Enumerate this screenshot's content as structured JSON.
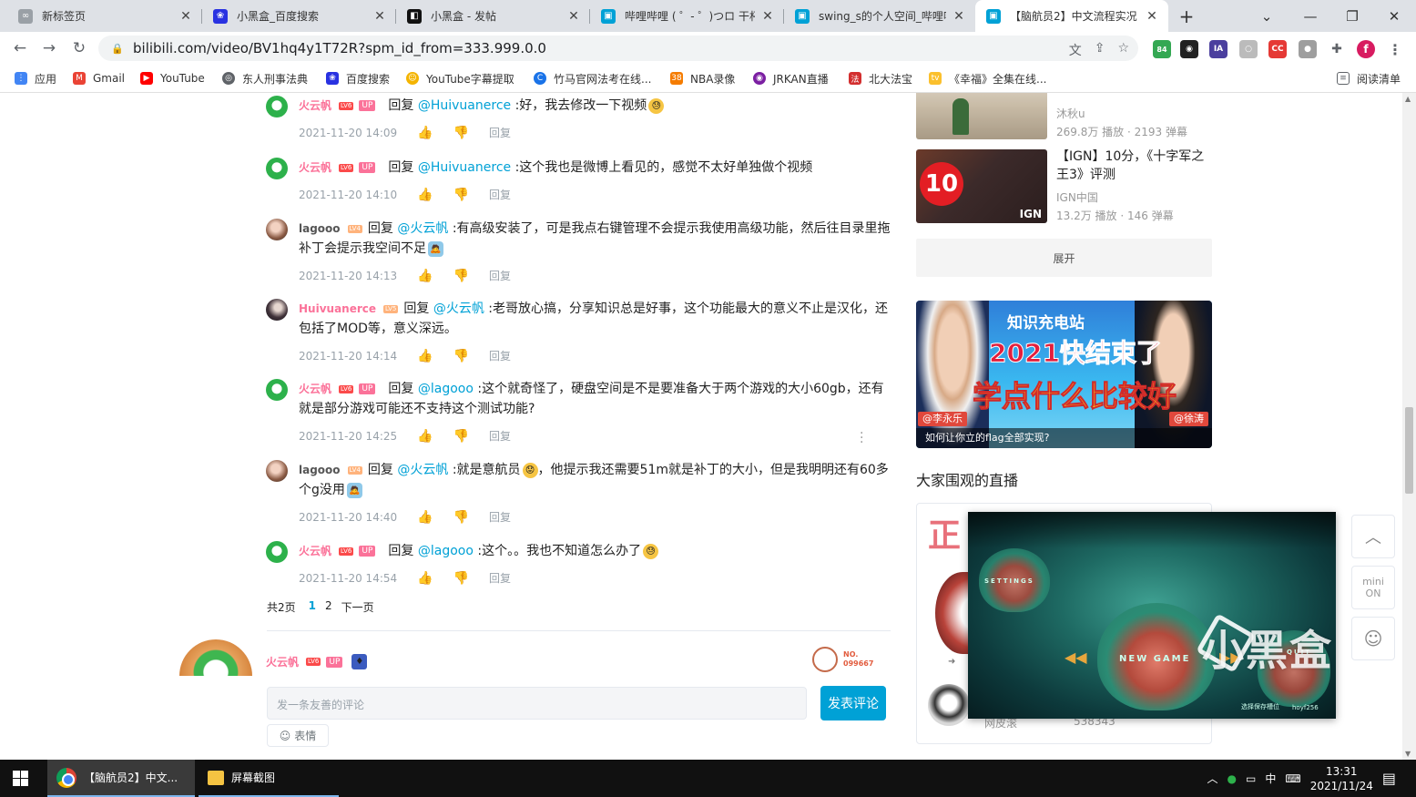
{
  "browser": {
    "tabs": [
      {
        "title": "新标签页",
        "icon": "new-tab-icon",
        "color": "#9aa0a6"
      },
      {
        "title": "小黑盒_百度搜索",
        "icon": "baidu-icon",
        "color": "#2932e1"
      },
      {
        "title": "小黑盒 - 发帖",
        "icon": "heybox-icon",
        "color": "#111111"
      },
      {
        "title": "哔哩哔哩 ( ゜- ゜)つロ 干杯~",
        "icon": "bilibili-icon",
        "color": "#00a1d6"
      },
      {
        "title": "swing_s的个人空间_哔哩哔",
        "icon": "bilibili-icon",
        "color": "#00a1d6"
      },
      {
        "title": "【脑航员2】中文流程实况",
        "icon": "bilibili-icon",
        "color": "#00a1d6"
      }
    ],
    "new_tab": "+",
    "url": "bilibili.com/video/BV1hq4y1T72R?spm_id_from=333.999.0.0",
    "profile_initial": "f",
    "ext_badge": "84"
  },
  "bookmarks": [
    {
      "label": "应用",
      "icon": "apps-grid-icon",
      "color": "#4285f4"
    },
    {
      "label": "Gmail",
      "icon": "gmail-icon",
      "color": "#ea4335"
    },
    {
      "label": "YouTube",
      "icon": "youtube-icon",
      "color": "#ff0000"
    },
    {
      "label": "东人刑事法典",
      "icon": "globe-icon",
      "color": "#5f6368"
    },
    {
      "label": "百度搜索",
      "icon": "baidu-icon",
      "color": "#2932e1"
    },
    {
      "label": "YouTube字幕提取",
      "icon": "smile-icon",
      "color": "#f4b400"
    },
    {
      "label": "竹马官网法考在线...",
      "icon": "site-icon",
      "color": "#1a73e8"
    },
    {
      "label": "NBA录像",
      "icon": "nba-icon",
      "color": "#f57c00"
    },
    {
      "label": "JRKAN直播",
      "icon": "jrkan-icon",
      "color": "#7b1fa2"
    },
    {
      "label": "北大法宝",
      "icon": "pkulaw-icon",
      "color": "#d32f2f"
    },
    {
      "label": "《幸福》全集在线...",
      "icon": "tv-icon",
      "color": "#fbc02d"
    }
  ],
  "reading_list": "阅读清单",
  "replies": [
    {
      "user": "火云帆",
      "level": "LV6",
      "up": "UP",
      "reply": "回复",
      "at": "@Huivuanerce",
      "text": ":好，我去修改一下视频",
      "emoji": "😓",
      "time": "2021-11-20 14:09",
      "reply_btn": "回复",
      "avatar": "green"
    },
    {
      "user": "火云帆",
      "level": "LV6",
      "up": "UP",
      "reply": "回复",
      "at": "@Huivuanerce",
      "text": ":这个我也是微博上看见的，感觉不太好单独做个视频",
      "emoji": "",
      "time": "2021-11-20 14:10",
      "reply_btn": "回复",
      "avatar": "green"
    },
    {
      "user": "lagooo",
      "level": "LV4",
      "up": "",
      "reply": "回复",
      "at": "@火云帆",
      "text": ":有高级安装了，可是我点右键管理不会提示我使用高级功能，然后往目录里拖补丁会提示我空间不足",
      "emoji": "🙇",
      "time": "2021-11-20 14:13",
      "reply_btn": "回复",
      "avatar": "brown"
    },
    {
      "user": "Huivuanerce",
      "level": "LV5",
      "up": "",
      "reply": "回复",
      "at": "@火云帆",
      "text": ":老哥放心搞，分享知识总是好事，这个功能最大的意义不止是汉化，还包括了MOD等，意义深远。",
      "emoji": "",
      "time": "2021-11-20 14:14",
      "reply_btn": "回复",
      "avatar": "dark"
    },
    {
      "user": "火云帆",
      "level": "LV6",
      "up": "UP",
      "reply": "回复",
      "at": "@lagooo",
      "text": ":这个就奇怪了，硬盘空间是不是要准备大于两个游戏的大小60gb，还有就是部分游戏可能还不支持这个测试功能?",
      "emoji": "",
      "time": "2021-11-20 14:25",
      "reply_btn": "回复",
      "avatar": "green"
    },
    {
      "user": "lagooo",
      "level": "LV4",
      "up": "",
      "reply": "回复",
      "at": "@火云帆",
      "text": ":就是意航员",
      "emoji": "😟",
      "text2": "，他提示我还需要51m就是补丁的大小，但是我明明还有60多个g没用",
      "emoji2": "🙇",
      "time": "2021-11-20 14:40",
      "reply_btn": "回复",
      "avatar": "brown"
    },
    {
      "user": "火云帆",
      "level": "LV6",
      "up": "UP",
      "reply": "回复",
      "at": "@lagooo",
      "text": ":这个。。我也不知道怎么办了",
      "emoji": "😓",
      "time": "2021-11-20 14:54",
      "reply_btn": "回复",
      "avatar": "green"
    }
  ],
  "pager": {
    "total": "共2页",
    "page1": "1",
    "page2": "2",
    "next": "下一页"
  },
  "composer": {
    "user": "火云帆",
    "level": "LV6",
    "up": "UP",
    "nft_no": "NO.",
    "nft_id": "099667",
    "placeholder": "发一条友善的评论",
    "submit": "发表评论",
    "emoji_label": "表情"
  },
  "recommendations": [
    {
      "title": "",
      "author": "沐秋u",
      "stats": "269.8万 播放 · 2193 弹幕"
    },
    {
      "title": "【IGN】10分，《十字军之王3》评测",
      "author": "IGN中国",
      "stats": "13.2万 播放 · 146 弹幕",
      "thumb_text": "10",
      "thumb_brand": "IGN"
    }
  ],
  "expand_label": "展开",
  "banner": {
    "headline1": "知识充电站",
    "headline2": "2021快结束了",
    "headline3": "学点什么比较好",
    "tag_left": "@李永乐",
    "tag_right": "@徐涛",
    "caption": "如何让你立的flag全部实现?"
  },
  "live_section": {
    "title": "大家围观的直播",
    "glyph": "正",
    "streamer": "网皮滚",
    "viewers": "538343"
  },
  "mini_player": {
    "left_label": "SETTINGS",
    "center_label": "NEW GAME",
    "right_label": "QUIT",
    "footer_left": "选择保存槽位",
    "footer_right": "hoyf256"
  },
  "side_tools": {
    "mini": "mini",
    "mini_state": "ON"
  },
  "watermark": "小黑盒",
  "taskbar": {
    "tasks": [
      {
        "label": "【脑航员2】中文..."
      },
      {
        "label": "屏幕截图"
      }
    ],
    "ime": "中",
    "time": "13:31",
    "date": "2021/11/24"
  }
}
